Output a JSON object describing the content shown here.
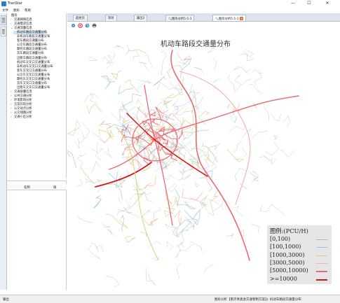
{
  "window": {
    "title": "TranStar",
    "minimize": "—",
    "maximize": "☐",
    "close": "✕"
  },
  "menu": [
    "文件",
    "图形",
    "帮助"
  ],
  "sidetabs": [
    "项目",
    "图层"
  ],
  "tree": [
    {
      "label": "图形",
      "arrow": "",
      "indent": 0
    },
    {
      "label": "交通网络信息",
      "arrow": "›",
      "indent": 1
    },
    {
      "label": "交通需求信息",
      "arrow": "›",
      "indent": 1
    },
    {
      "label": "交通流量信息",
      "arrow": "⌄",
      "indent": 1
    },
    {
      "label": "机动车路段交通量分布",
      "arrow": "",
      "indent": 2,
      "selected": true
    },
    {
      "label": "非机动车路段交通量分布",
      "arrow": "",
      "indent": 2
    },
    {
      "label": "客车路段交通量分布",
      "arrow": "",
      "indent": 2
    },
    {
      "label": "公交车路段交通量分布",
      "arrow": "",
      "indent": 2
    },
    {
      "label": "摩托车路段交通量分布",
      "arrow": "",
      "indent": 2
    },
    {
      "label": "货车路段交通量分布",
      "arrow": "",
      "indent": 2
    },
    {
      "label": "出租车路段交通量分布",
      "arrow": "",
      "indent": 2
    },
    {
      "label": "机动车交叉口交通量分布",
      "arrow": "",
      "indent": 2
    },
    {
      "label": "非机动车交叉口交通量分布",
      "arrow": "",
      "indent": 2
    },
    {
      "label": "客车交叉口交通量分布",
      "arrow": "",
      "indent": 2
    },
    {
      "label": "公交车交叉口交通量分布",
      "arrow": "",
      "indent": 2
    },
    {
      "label": "摩托车交叉口交通量分布",
      "arrow": "",
      "indent": 2
    },
    {
      "label": "货车交叉口交通量分布",
      "arrow": "",
      "indent": 2
    },
    {
      "label": "出租车交叉口交通量分布",
      "arrow": "",
      "indent": 2
    },
    {
      "label": "交通质量信息",
      "arrow": "›",
      "indent": 1
    },
    {
      "label": "公共交通分析",
      "arrow": "›",
      "indent": 1
    },
    {
      "label": "环境影响分析",
      "arrow": "›",
      "indent": 1
    },
    {
      "label": "方案比较分析",
      "arrow": "›",
      "indent": 1
    },
    {
      "label": "公交站点分析",
      "arrow": "›",
      "indent": 1
    },
    {
      "label": "公交线路分析",
      "arrow": "›",
      "indent": 1
    },
    {
      "label": "交通小区分析",
      "arrow": "›",
      "indent": 1
    }
  ],
  "props": {
    "col_name": "名称",
    "col_value": "值"
  },
  "tabs": [
    {
      "label": "起始页",
      "active": false,
      "icon": ""
    },
    {
      "label": "项目",
      "active": false,
      "icon": ""
    },
    {
      "label": "输出2",
      "active": false,
      "icon": ""
    },
    {
      "label": "图形分析5-1-1",
      "active": false,
      "icon": "🔍"
    },
    {
      "label": "图形分析5-1-1",
      "active": true,
      "icon": "🔍",
      "closable": true
    }
  ],
  "toolbar": [
    "settings-icon",
    "target-icon",
    "refresh-icon",
    "print-icon"
  ],
  "map": {
    "title": "机动车路段交通量分布"
  },
  "legend": {
    "title": "图例:(PCU/H)",
    "items": [
      {
        "label": "[0,100)",
        "color": "#b9b9b9"
      },
      {
        "label": "[100,1000)",
        "color": "#9ec3d8"
      },
      {
        "label": "[1000,3000)",
        "color": "#d8d07a"
      },
      {
        "label": "[3000,5000)",
        "color": "#f1b2a6"
      },
      {
        "label": "[5000,10000)",
        "color": "#e86a72"
      },
      {
        "label": ">=10000",
        "color": "#d01818"
      }
    ]
  },
  "status": {
    "left": "输出",
    "right": "图形分析【南京青奥会交通管制方案】》机动车路段交通量分布"
  }
}
